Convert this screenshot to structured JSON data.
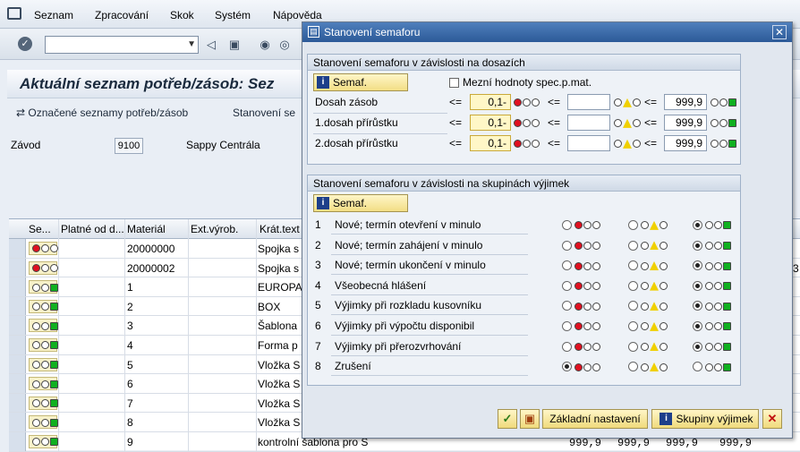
{
  "menu": {
    "items": [
      "Seznam",
      "Zpracování",
      "Skok",
      "Systém",
      "Nápověda"
    ]
  },
  "main": {
    "title": "Aktuální seznam potřeb/zásob: Sez",
    "toolbar": {
      "btn1": "Označené seznamy potřeb/zásob",
      "btn2": "Stanovení se"
    },
    "plant_label": "Závod",
    "plant_value": "9100",
    "plant_name": "Sappy Centrála",
    "columns": [
      "Se...",
      "Platné od d...",
      "Materiál",
      "Ext.výrob.",
      "Krát.text"
    ],
    "rows": [
      {
        "light": "red",
        "material": "20000000",
        "text": "Spojka s"
      },
      {
        "light": "red",
        "material": "20000002",
        "text": "Spojka s"
      },
      {
        "light": "green",
        "material": "1",
        "text": "EUROPA"
      },
      {
        "light": "green",
        "material": "2",
        "text": "BOX"
      },
      {
        "light": "green",
        "material": "3",
        "text": "Šablona"
      },
      {
        "light": "green",
        "material": "4",
        "text": "Forma p"
      },
      {
        "light": "green",
        "material": "5",
        "text": "Vložka S"
      },
      {
        "light": "green",
        "material": "6",
        "text": "Vložka S"
      },
      {
        "light": "green",
        "material": "7",
        "text": "Vložka S"
      },
      {
        "light": "green",
        "material": "8",
        "text": "Vložka S"
      },
      {
        "light": "green",
        "material": "9",
        "text": "kontrolní šablona pro S"
      }
    ],
    "right_values": [
      "999,9",
      "999,9",
      "999,9",
      "999,9"
    ],
    "right_edge_digit": "3"
  },
  "dialog": {
    "title": "Stanovení semaforu",
    "group1": {
      "header": "Stanovení semaforu v závislosti na dosazích",
      "button": "Semaf.",
      "checkbox_label": "Mezní hodnoty spec.p.mat.",
      "rows": [
        {
          "label": "Dosah zásob",
          "op1": "<=",
          "v1": "0,1-",
          "op2": "<=",
          "v2": "",
          "op3": "<=",
          "v3": "999,9"
        },
        {
          "label": "1.dosah přírůstku",
          "op1": "<=",
          "v1": "0,1-",
          "op2": "<=",
          "v2": "",
          "op3": "<=",
          "v3": "999,9"
        },
        {
          "label": "2.dosah přírůstku",
          "op1": "<=",
          "v1": "0,1-",
          "op2": "<=",
          "v2": "",
          "op3": "<=",
          "v3": "999,9"
        }
      ]
    },
    "group2": {
      "header": "Stanovení semaforu v závislosti na skupinách výjimek",
      "button": "Semaf.",
      "rows": [
        {
          "num": "1",
          "label": "Nové; termín otevření v minulo",
          "selected": 2
        },
        {
          "num": "2",
          "label": "Nové; termín zahájení v minulo",
          "selected": 2
        },
        {
          "num": "3",
          "label": "Nové; termín ukončení v minulo",
          "selected": 2
        },
        {
          "num": "4",
          "label": "Všeobecná hlášení",
          "selected": 2
        },
        {
          "num": "5",
          "label": "Výjimky při rozkladu kusovníku",
          "selected": 2
        },
        {
          "num": "6",
          "label": "Výjimky při výpočtu disponibil",
          "selected": 2
        },
        {
          "num": "7",
          "label": "Výjimky při přerozvrhování",
          "selected": 2
        },
        {
          "num": "8",
          "label": "Zrušení",
          "selected": 0
        }
      ]
    },
    "footer": {
      "default_btn": "Základní nastavení",
      "groups_btn": "Skupiny výjimek"
    }
  }
}
